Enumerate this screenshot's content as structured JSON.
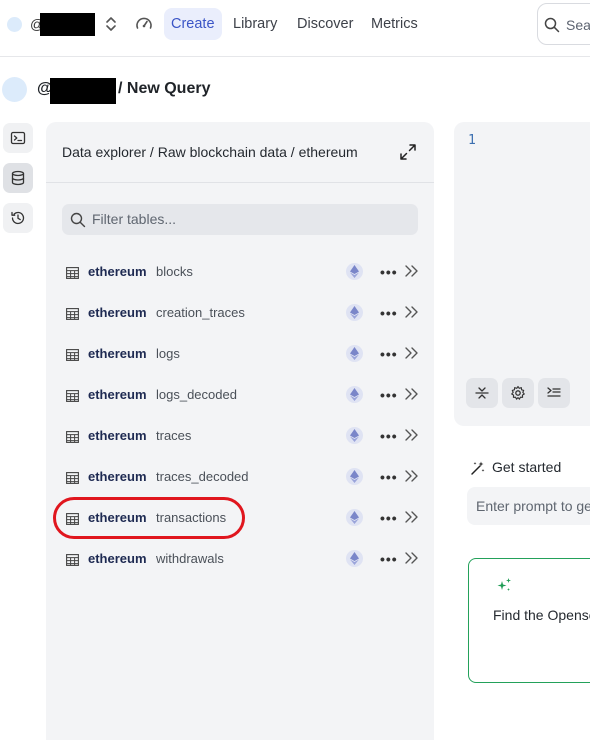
{
  "topbar": {
    "at_symbol": "@",
    "tabs": [
      {
        "label": "Create",
        "active": true
      },
      {
        "label": "Library",
        "active": false
      },
      {
        "label": "Discover",
        "active": false
      },
      {
        "label": "Metrics",
        "active": false
      }
    ],
    "search_placeholder": "Sea"
  },
  "page": {
    "at_symbol": "@",
    "title": "/ New Query"
  },
  "sidebar": {
    "buttons": [
      {
        "icon": "terminal-icon",
        "active": false
      },
      {
        "icon": "database-icon",
        "active": true
      },
      {
        "icon": "history-icon",
        "active": false
      }
    ]
  },
  "explorer": {
    "breadcrumb": "Data explorer / Raw blockchain data / ethereum",
    "filter_placeholder": "Filter tables...",
    "tables": [
      {
        "schema": "ethereum",
        "name": "blocks"
      },
      {
        "schema": "ethereum",
        "name": "creation_traces"
      },
      {
        "schema": "ethereum",
        "name": "logs"
      },
      {
        "schema": "ethereum",
        "name": "logs_decoded"
      },
      {
        "schema": "ethereum",
        "name": "traces"
      },
      {
        "schema": "ethereum",
        "name": "traces_decoded"
      },
      {
        "schema": "ethereum",
        "name": "transactions",
        "highlighted": true
      },
      {
        "schema": "ethereum",
        "name": "withdrawals"
      }
    ],
    "row_menu": "•••"
  },
  "editor": {
    "line_number": "1"
  },
  "assistant": {
    "get_started": "Get started",
    "prompt_placeholder": "Enter prompt to ge",
    "suggestion": "Find the Opense by day."
  },
  "colors": {
    "accent": "#3b55c6",
    "highlight_ring": "#e0161e",
    "suggestion_border": "#23a15a"
  }
}
